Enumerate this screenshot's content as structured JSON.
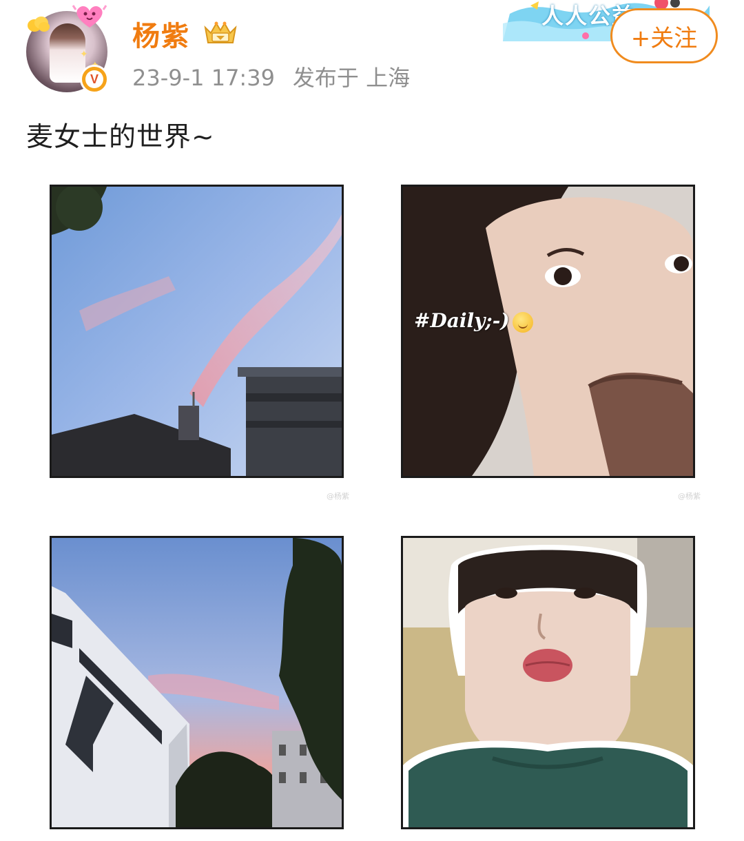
{
  "post": {
    "author": {
      "name": "杨紫",
      "verified_badge_letter": "V"
    },
    "meta": {
      "date": "23-9-1 17:39",
      "location": "发布于 上海"
    },
    "follow_label": "+关注",
    "promo_banner_text": "人人公益",
    "text": "麦女士的世界~",
    "images": [
      {
        "name": "sunset-sky-buildings-1",
        "watermark": "@杨紫"
      },
      {
        "name": "selfie-eating-ice-cream",
        "sticker": "#Daily;-)",
        "sticker_emoji": "smile-emoji",
        "watermark": "@杨紫"
      },
      {
        "name": "sunset-sky-buildings-2"
      },
      {
        "name": "selfie-pout-face"
      }
    ]
  },
  "colors": {
    "username": "#f07c10",
    "follow_border": "#f08b1e",
    "meta_text": "#8f8f8f",
    "verified": "#f6a31a"
  }
}
